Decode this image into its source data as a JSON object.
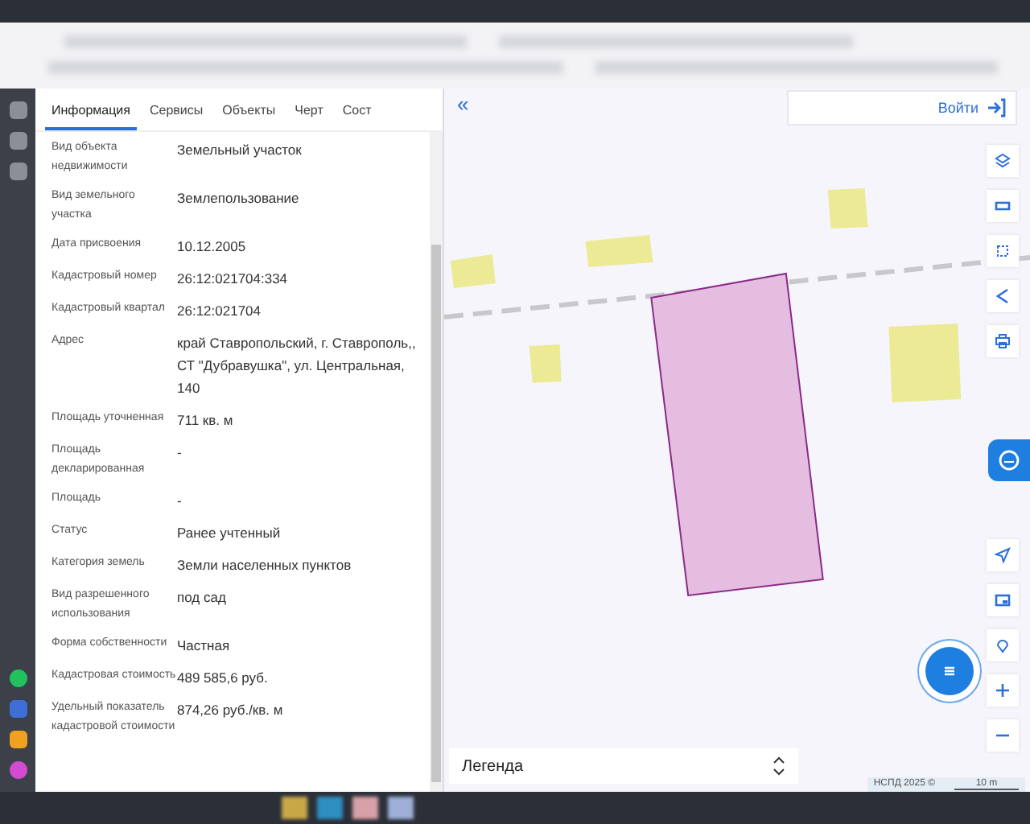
{
  "tabs": [
    {
      "label": "Информация",
      "selected": true
    },
    {
      "label": "Сервисы",
      "selected": false
    },
    {
      "label": "Объекты",
      "selected": false
    },
    {
      "label": "Черт",
      "selected": false
    },
    {
      "label": "Сост",
      "selected": false
    }
  ],
  "collapse_button": "«",
  "fields": [
    {
      "label": "Вид объекта недвижимости",
      "value": "Земельный участок"
    },
    {
      "label": "Вид земельного участка",
      "value": "Землепользование"
    },
    {
      "label": "Дата присвоения",
      "value": "10.12.2005"
    },
    {
      "label": "Кадастровый номер",
      "value": "26:12:021704:334"
    },
    {
      "label": "Кадастровый квартал",
      "value": "26:12:021704"
    },
    {
      "label": "Адрес",
      "value": "край Ставропольский, г. Ставрополь,, СТ \"Дубравушка\", ул. Центральная, 140"
    },
    {
      "label": "Площадь уточненная",
      "value": "711 кв. м"
    },
    {
      "label": "Площадь декларированная",
      "value": "-"
    },
    {
      "label": "Площадь",
      "value": "-"
    },
    {
      "label": "Статус",
      "value": "Ранее учтенный"
    },
    {
      "label": "Категория земель",
      "value": "Земли населенных пунктов"
    },
    {
      "label": "Вид разрешенного использования",
      "value": "под сад"
    },
    {
      "label": "Форма собственности",
      "value": "Частная"
    },
    {
      "label": "Кадастровая стоимость",
      "value": "489 585,6 руб."
    },
    {
      "label": "Удельный показатель кадастровой стоимости",
      "value": "874,26 руб./кв. м"
    }
  ],
  "login_button": "Войти",
  "legend": "Легенда",
  "copyright": "НСПД 2025 ©",
  "scale": "10 m"
}
